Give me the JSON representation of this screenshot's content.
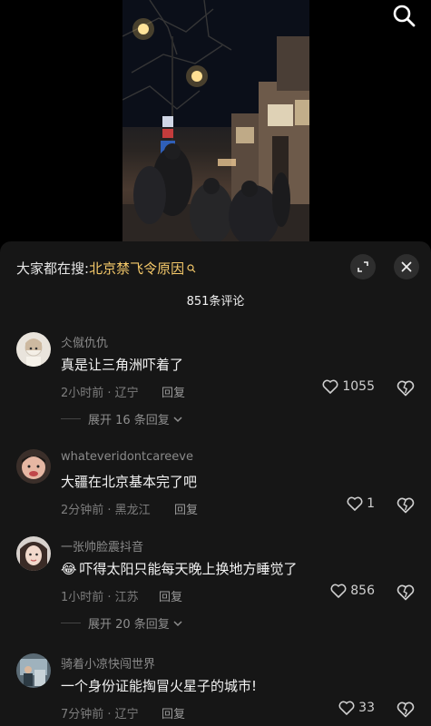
{
  "video": {
    "search_icon": "search-icon"
  },
  "sheet": {
    "search_prefix": "大家都在搜:",
    "search_keyword": "北京禁飞令原因",
    "comment_count": "851条评论",
    "expand_icon": "expand-icon",
    "close_icon": "close-icon"
  },
  "comments": [
    {
      "user": "仌僦仇仇",
      "text": "真是让三角洲吓着了",
      "time_location": "2小时前 · 辽宁",
      "reply": "回复",
      "likes": "1055",
      "expand": "展开 16 条回复"
    },
    {
      "user": "whateveridontcareeve",
      "text": "大疆在北京基本完了吧",
      "time_location": "2分钟前 · 黑龙江",
      "reply": "回复",
      "likes": "1"
    },
    {
      "user": "一张帅脸震抖音",
      "emoji": "😂",
      "text": "吓得太阳只能每天晚上换地方睡觉了",
      "time_location": "1小时前 · 江苏",
      "reply": "回复",
      "likes": "856",
      "expand": "展开 20 条回复"
    },
    {
      "user": "骑着小凉快闯世界",
      "text": "一个身份证能掏冒火星子的城市!",
      "time_location": "7分钟前 · 辽宁",
      "reply": "回复",
      "likes": "33"
    }
  ],
  "colors": {
    "sheet_bg": "#161616",
    "keyword": "#f5c96a",
    "muted": "#7d7d7d"
  }
}
